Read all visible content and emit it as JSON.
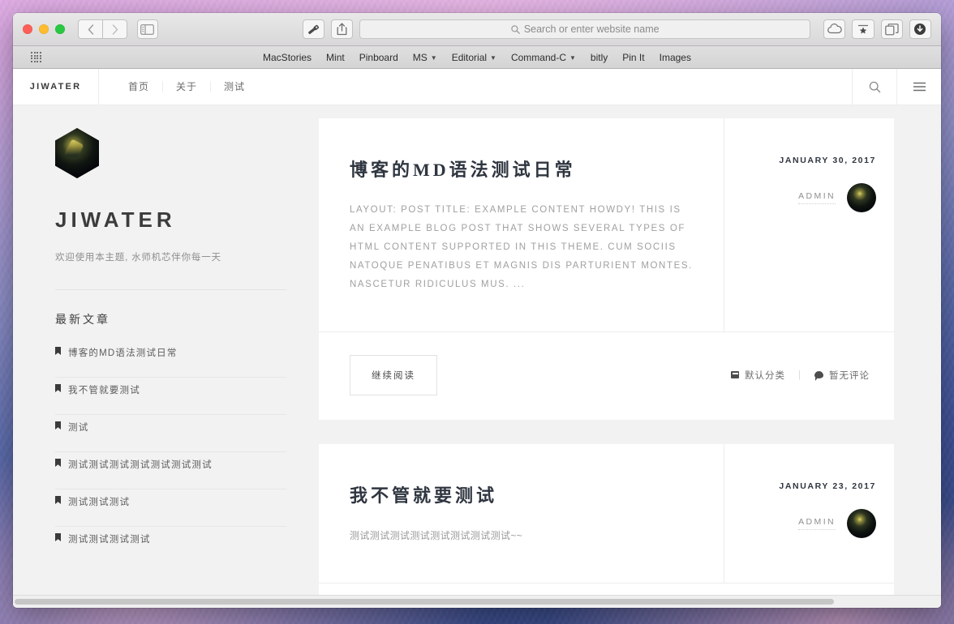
{
  "browser": {
    "address_placeholder": "Search or enter website name",
    "toolbar_icons": {
      "back": "back-chevron-icon",
      "forward": "forward-chevron-icon",
      "sidebar": "sidebar-toggle-icon",
      "password": "key-icon",
      "share": "share-icon",
      "icloud": "cloud-icon",
      "reading_list": "bookmark-star-icon",
      "tabs": "tab-overview-icon",
      "downloads": "download-icon",
      "search": "search-icon"
    },
    "favorites": [
      {
        "label": "MacStories",
        "has_menu": false
      },
      {
        "label": "Mint",
        "has_menu": false
      },
      {
        "label": "Pinboard",
        "has_menu": false
      },
      {
        "label": "MS",
        "has_menu": true
      },
      {
        "label": "Editorial",
        "has_menu": true
      },
      {
        "label": "Command-C",
        "has_menu": true
      },
      {
        "label": "bitly",
        "has_menu": false
      },
      {
        "label": "Pin It",
        "has_menu": false
      },
      {
        "label": "Images",
        "has_menu": false
      }
    ]
  },
  "site": {
    "brand": "JIWATER",
    "nav": [
      "首页",
      "关于",
      "测试"
    ],
    "header_actions": [
      "search-icon",
      "menu-icon"
    ]
  },
  "sidebar": {
    "title": "JIWATER",
    "tagline": "欢迎使用本主题, 水师机芯伴你每一天",
    "recent_heading": "最新文章",
    "recent_posts": [
      "博客的MD语法测试日常",
      "我不管就要测试",
      "测试",
      "测试测试测试测试测试测试测试",
      "测试测试测试",
      "测试测试测试测试"
    ]
  },
  "posts": [
    {
      "title": "博客的MD语法测试日常",
      "excerpt": "LAYOUT: POST TITLE: EXAMPLE CONTENT HOWDY! THIS IS AN EXAMPLE BLOG POST THAT SHOWS SEVERAL TYPES OF HTML CONTENT SUPPORTED IN THIS THEME. CUM SOCIIS NATOQUE PENATIBUS ET MAGNIS DIS PARTURIENT MONTES. NASCETUR RIDICULUS MUS. ...",
      "date": "JANUARY 30, 2017",
      "author": "ADMIN",
      "read_more": "继续阅读",
      "category": "默认分类",
      "comments": "暂无评论"
    },
    {
      "title": "我不管就要测试",
      "excerpt": "测试测试测试测试测试测试测试测试~~",
      "date": "JANUARY 23, 2017",
      "author": "ADMIN"
    }
  ],
  "colors": {
    "page_bg": "#f2f2f2",
    "card_bg": "#ffffff",
    "title_text": "#2f3640",
    "muted_text": "#a0a0a0"
  }
}
